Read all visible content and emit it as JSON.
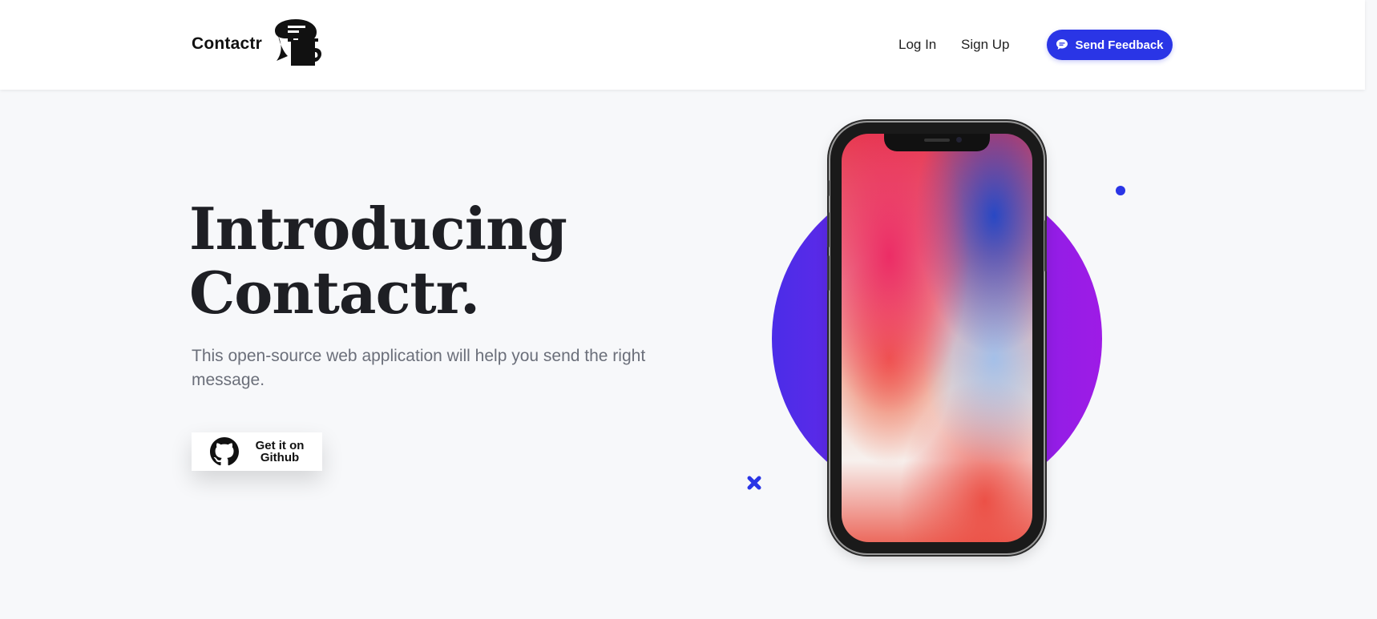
{
  "nav": {
    "brand": "Contactr",
    "login": "Log In",
    "signup": "Sign Up",
    "feedback": "Send Feedback"
  },
  "hero": {
    "title_line1": "Introducing",
    "title_line2": "Contactr.",
    "subtitle": "This open-source web application will help you send the right message.",
    "github_line1": "Get it on",
    "github_line2": "Github"
  },
  "icons": {
    "logo": "speech-bubble-cup-logo",
    "feedback": "chat-icon",
    "github": "github-icon",
    "cross": "cross-icon"
  },
  "colors": {
    "accent": "#2a35e6",
    "circle_start": "#4b2de8",
    "circle_end": "#9e1be6",
    "title": "#1e1f24",
    "subtitle": "#6b6f7a",
    "background": "#f7f8fa"
  }
}
